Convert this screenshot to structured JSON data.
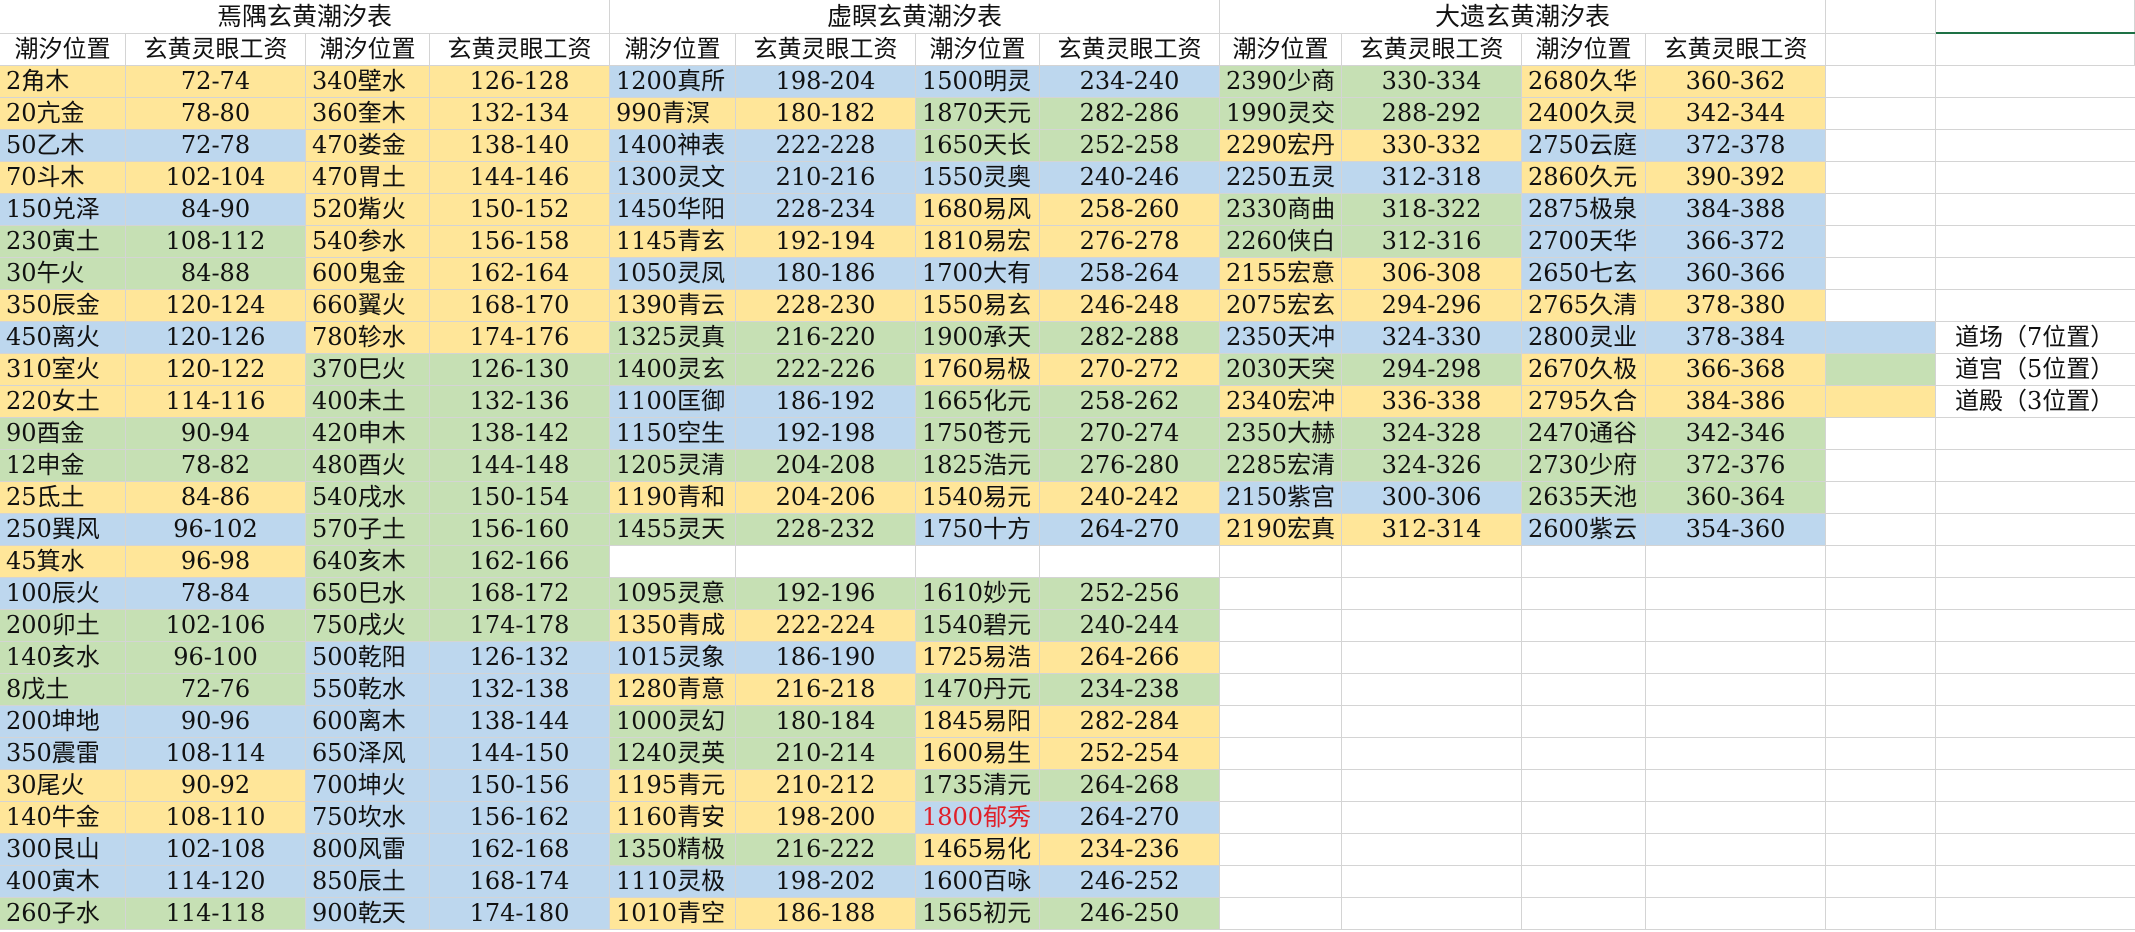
{
  "colors": {
    "yellow": "#ffe699",
    "green": "#c6e0b4",
    "blue": "#bdd7ee",
    "white": "#ffffff",
    "red_text": "#e0202a"
  },
  "tables": [
    {
      "title": "焉隅玄黄潮汐表",
      "headers": [
        "潮汐位置",
        "玄黄灵眼工资",
        "潮汐位置",
        "玄黄灵眼工资"
      ],
      "rows": [
        [
          [
            "2角木",
            "72-74",
            "y"
          ],
          [
            "340壁水",
            "126-128",
            "y"
          ]
        ],
        [
          [
            "20亢金",
            "78-80",
            "y"
          ],
          [
            "360奎木",
            "132-134",
            "y"
          ]
        ],
        [
          [
            "50乙木",
            "72-78",
            "b"
          ],
          [
            "470娄金",
            "138-140",
            "y"
          ]
        ],
        [
          [
            "70斗木",
            "102-104",
            "y"
          ],
          [
            "470胃土",
            "144-146",
            "y"
          ]
        ],
        [
          [
            "150兑泽",
            "84-90",
            "b"
          ],
          [
            "520觜火",
            "150-152",
            "y"
          ]
        ],
        [
          [
            "230寅土",
            "108-112",
            "g"
          ],
          [
            "540参水",
            "156-158",
            "y"
          ]
        ],
        [
          [
            "30午火",
            "84-88",
            "g"
          ],
          [
            "600鬼金",
            "162-164",
            "y"
          ]
        ],
        [
          [
            "350辰金",
            "120-124",
            "y"
          ],
          [
            "660翼火",
            "168-170",
            "y"
          ]
        ],
        [
          [
            "450离火",
            "120-126",
            "b"
          ],
          [
            "780轸水",
            "174-176",
            "y"
          ]
        ],
        [
          [
            "310室火",
            "120-122",
            "y"
          ],
          [
            "370巳火",
            "126-130",
            "g"
          ]
        ],
        [
          [
            "220女土",
            "114-116",
            "y"
          ],
          [
            "400未土",
            "132-136",
            "g"
          ]
        ],
        [
          [
            "90酉金",
            "90-94",
            "g"
          ],
          [
            "420申木",
            "138-142",
            "g"
          ]
        ],
        [
          [
            "12申金",
            "78-82",
            "g"
          ],
          [
            "480酉火",
            "144-148",
            "g"
          ]
        ],
        [
          [
            "25氐土",
            "84-86",
            "y"
          ],
          [
            "540戌水",
            "150-154",
            "g"
          ]
        ],
        [
          [
            "250巽风",
            "96-102",
            "b"
          ],
          [
            "570子土",
            "156-160",
            "g"
          ]
        ],
        [
          [
            "45箕水",
            "96-98",
            "y"
          ],
          [
            "640亥木",
            "162-166",
            "g"
          ]
        ],
        [
          [
            "100辰火",
            "78-84",
            "b"
          ],
          [
            "650巳水",
            "168-172",
            "g"
          ]
        ],
        [
          [
            "200卯土",
            "102-106",
            "g"
          ],
          [
            "750戌火",
            "174-178",
            "g"
          ]
        ],
        [
          [
            "140亥水",
            "96-100",
            "g"
          ],
          [
            "500乾阳",
            "126-132",
            "b"
          ]
        ],
        [
          [
            "8戊土",
            "72-76",
            "g"
          ],
          [
            "550乾水",
            "132-138",
            "b"
          ]
        ],
        [
          [
            "200坤地",
            "90-96",
            "b"
          ],
          [
            "600离木",
            "138-144",
            "b"
          ]
        ],
        [
          [
            "350震雷",
            "108-114",
            "b"
          ],
          [
            "650泽风",
            "144-150",
            "b"
          ]
        ],
        [
          [
            "30尾火",
            "90-92",
            "y"
          ],
          [
            "700坤火",
            "150-156",
            "b"
          ]
        ],
        [
          [
            "140牛金",
            "108-110",
            "y"
          ],
          [
            "750坎水",
            "156-162",
            "b"
          ]
        ],
        [
          [
            "300艮山",
            "102-108",
            "b"
          ],
          [
            "800风雷",
            "162-168",
            "b"
          ]
        ],
        [
          [
            "400寅木",
            "114-120",
            "b"
          ],
          [
            "850辰土",
            "168-174",
            "b"
          ]
        ],
        [
          [
            "260子水",
            "114-118",
            "g"
          ],
          [
            "900乾天",
            "174-180",
            "b"
          ]
        ]
      ]
    },
    {
      "title": "虚瞑玄黄潮汐表",
      "headers": [
        "潮汐位置",
        "玄黄灵眼工资",
        "潮汐位置",
        "玄黄灵眼工资"
      ],
      "rows": [
        [
          [
            "1200真所",
            "198-204",
            "b"
          ],
          [
            "1500明灵",
            "234-240",
            "b"
          ]
        ],
        [
          [
            "990青溟",
            "180-182",
            "y"
          ],
          [
            "1870天元",
            "282-286",
            "g"
          ]
        ],
        [
          [
            "1400神表",
            "222-228",
            "b"
          ],
          [
            "1650天长",
            "252-258",
            "g"
          ]
        ],
        [
          [
            "1300灵文",
            "210-216",
            "b"
          ],
          [
            "1550灵奥",
            "240-246",
            "b"
          ]
        ],
        [
          [
            "1450华阳",
            "228-234",
            "b"
          ],
          [
            "1680易风",
            "258-260",
            "y"
          ]
        ],
        [
          [
            "1145青玄",
            "192-194",
            "y"
          ],
          [
            "1810易宏",
            "276-278",
            "y"
          ]
        ],
        [
          [
            "1050灵凤",
            "180-186",
            "b"
          ],
          [
            "1700大有",
            "258-264",
            "b"
          ]
        ],
        [
          [
            "1390青云",
            "228-230",
            "y"
          ],
          [
            "1550易玄",
            "246-248",
            "y"
          ]
        ],
        [
          [
            "1325灵真",
            "216-220",
            "g"
          ],
          [
            "1900承天",
            "282-288",
            "g"
          ]
        ],
        [
          [
            "1400灵玄",
            "222-226",
            "g"
          ],
          [
            "1760易极",
            "270-272",
            "y"
          ]
        ],
        [
          [
            "1100匡御",
            "186-192",
            "b"
          ],
          [
            "1665化元",
            "258-262",
            "g"
          ]
        ],
        [
          [
            "1150空生",
            "192-198",
            "b"
          ],
          [
            "1750苍元",
            "270-274",
            "g"
          ]
        ],
        [
          [
            "1205灵清",
            "204-208",
            "g"
          ],
          [
            "1825浩元",
            "276-280",
            "g"
          ]
        ],
        [
          [
            "1190青和",
            "204-206",
            "y"
          ],
          [
            "1540易元",
            "240-242",
            "y"
          ]
        ],
        [
          [
            "1455灵天",
            "228-232",
            "g"
          ],
          [
            "1750十方",
            "264-270",
            "b"
          ]
        ],
        [
          [
            "",
            "",
            "w"
          ],
          [
            "",
            "",
            "w"
          ]
        ],
        [
          [
            "1095灵意",
            "192-196",
            "g"
          ],
          [
            "1610妙元",
            "252-256",
            "g"
          ]
        ],
        [
          [
            "1350青成",
            "222-224",
            "y"
          ],
          [
            "1540碧元",
            "240-244",
            "g"
          ]
        ],
        [
          [
            "1015灵象",
            "186-190",
            "b"
          ],
          [
            "1725易浩",
            "264-266",
            "y"
          ]
        ],
        [
          [
            "1280青意",
            "216-218",
            "y"
          ],
          [
            "1470丹元",
            "234-238",
            "g"
          ]
        ],
        [
          [
            "1000灵幻",
            "180-184",
            "g"
          ],
          [
            "1845易阳",
            "282-284",
            "y"
          ]
        ],
        [
          [
            "1240灵英",
            "210-214",
            "g"
          ],
          [
            "1600易生",
            "252-254",
            "y"
          ]
        ],
        [
          [
            "1195青元",
            "210-212",
            "y"
          ],
          [
            "1735清元",
            "264-268",
            "g"
          ]
        ],
        [
          [
            "1160青安",
            "198-200",
            "y"
          ],
          [
            "1800郁秀",
            "264-270",
            "b",
            "red"
          ]
        ],
        [
          [
            "1350精极",
            "216-222",
            "g"
          ],
          [
            "1465易化",
            "234-236",
            "y"
          ]
        ],
        [
          [
            "1110灵极",
            "198-202",
            "b"
          ],
          [
            "1600百咏",
            "246-252",
            "b"
          ]
        ],
        [
          [
            "1010青空",
            "186-188",
            "y"
          ],
          [
            "1565初元",
            "246-250",
            "g"
          ]
        ]
      ]
    },
    {
      "title": "大遗玄黄潮汐表",
      "headers": [
        "潮汐位置",
        "玄黄灵眼工资",
        "潮汐位置",
        "玄黄灵眼工资"
      ],
      "rows": [
        [
          [
            "2390少商",
            "330-334",
            "g"
          ],
          [
            "2680久华",
            "360-362",
            "y"
          ]
        ],
        [
          [
            "1990灵交",
            "288-292",
            "g"
          ],
          [
            "2400久灵",
            "342-344",
            "y"
          ]
        ],
        [
          [
            "2290宏丹",
            "330-332",
            "y"
          ],
          [
            "2750云庭",
            "372-378",
            "b"
          ]
        ],
        [
          [
            "2250五灵",
            "312-318",
            "b"
          ],
          [
            "2860久元",
            "390-392",
            "y"
          ]
        ],
        [
          [
            "2330商曲",
            "318-322",
            "g"
          ],
          [
            "2875极泉",
            "384-388",
            "b"
          ]
        ],
        [
          [
            "2260侠白",
            "312-316",
            "g"
          ],
          [
            "2700天华",
            "366-372",
            "b"
          ]
        ],
        [
          [
            "2155宏意",
            "306-308",
            "y"
          ],
          [
            "2650七玄",
            "360-366",
            "b"
          ]
        ],
        [
          [
            "2075宏玄",
            "294-296",
            "y"
          ],
          [
            "2765久清",
            "378-380",
            "y"
          ]
        ],
        [
          [
            "2350天冲",
            "324-330",
            "b"
          ],
          [
            "2800灵业",
            "378-384",
            "b"
          ]
        ],
        [
          [
            "2030天突",
            "294-298",
            "g"
          ],
          [
            "2670久极",
            "366-368",
            "y"
          ]
        ],
        [
          [
            "2340宏冲",
            "336-338",
            "y"
          ],
          [
            "2795久合",
            "384-386",
            "y"
          ]
        ],
        [
          [
            "2350大赫",
            "324-328",
            "g"
          ],
          [
            "2470通谷",
            "342-346",
            "g"
          ]
        ],
        [
          [
            "2285宏清",
            "324-326",
            "g"
          ],
          [
            "2730少府",
            "372-376",
            "g"
          ]
        ],
        [
          [
            "2150紫宫",
            "300-306",
            "b"
          ],
          [
            "2635天池",
            "360-364",
            "g"
          ]
        ],
        [
          [
            "2190宏真",
            "312-314",
            "y"
          ],
          [
            "2600紫云",
            "354-360",
            "b"
          ]
        ]
      ]
    }
  ],
  "legend": [
    {
      "label": "道场（7位置）",
      "color": "b"
    },
    {
      "label": "道宫（5位置）",
      "color": "g"
    },
    {
      "label": "道殿（3位置）",
      "color": "y"
    }
  ]
}
